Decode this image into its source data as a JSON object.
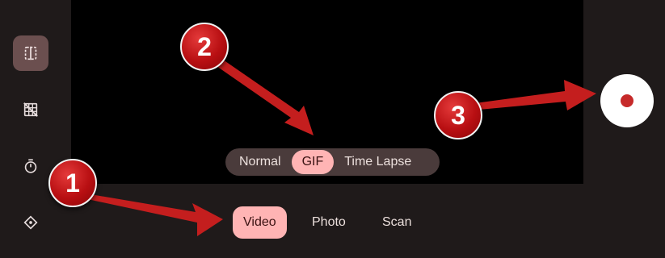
{
  "sidebar": {
    "items": [
      {
        "icon": "split-screen-icon",
        "active": true
      },
      {
        "icon": "grid-off-icon",
        "active": false
      },
      {
        "icon": "timer-icon",
        "active": false
      },
      {
        "icon": "level-center-icon",
        "active": false
      }
    ]
  },
  "submodes": [
    {
      "label": "Normal",
      "selected": false
    },
    {
      "label": "GIF",
      "selected": true
    },
    {
      "label": "Time Lapse",
      "selected": false
    }
  ],
  "modes": [
    {
      "label": "Video",
      "selected": true
    },
    {
      "label": "Photo",
      "selected": false
    },
    {
      "label": "Scan",
      "selected": false
    }
  ],
  "shutter": {
    "icon": "record-icon"
  },
  "annotations": [
    "1",
    "2",
    "3"
  ],
  "colors": {
    "background": "#1f1a1a",
    "accent": "#ffb4b4",
    "annotation_red": "#c41e1e",
    "record_red": "#c62a2a"
  }
}
